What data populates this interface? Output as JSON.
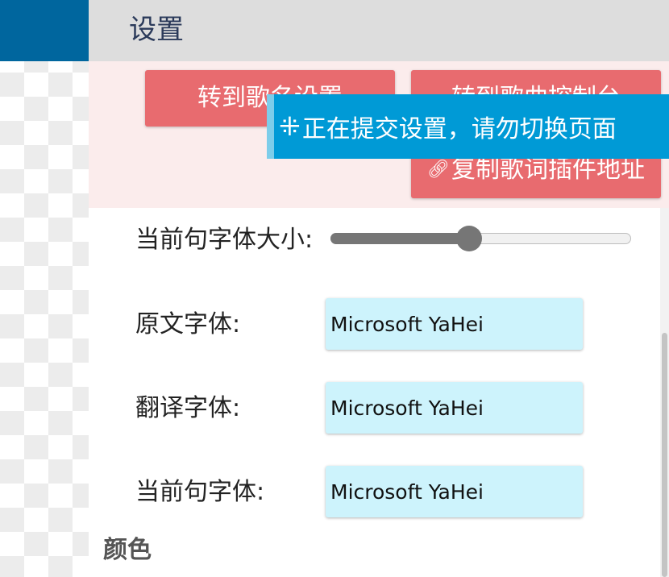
{
  "header": {
    "title": "设置"
  },
  "buttons": {
    "song_settings": "转到歌名设置",
    "song_console": "转到歌曲控制台",
    "copy_lyrics_url": "复制歌词插件地址"
  },
  "toast": {
    "message": "正在提交设置，请勿切换页面"
  },
  "settings": {
    "current_font_size_label": "当前句字体大小:",
    "current_font_size_value": 0.46,
    "original_font_label": "原文字体:",
    "original_font_value": "Microsoft YaHei",
    "translation_font_label": "翻译字体:",
    "translation_font_value": "Microsoft YaHei",
    "current_font_label": "当前句字体:",
    "current_font_value": "Microsoft YaHei"
  },
  "sections": {
    "color": "颜色"
  },
  "icons": {
    "spinner": "spinner-icon",
    "link": "link-icon"
  },
  "colors": {
    "brand_blue": "#00669e",
    "button_red": "#e86b6f",
    "toast_blue": "#009ad6",
    "input_bg": "#cdf3fc"
  }
}
